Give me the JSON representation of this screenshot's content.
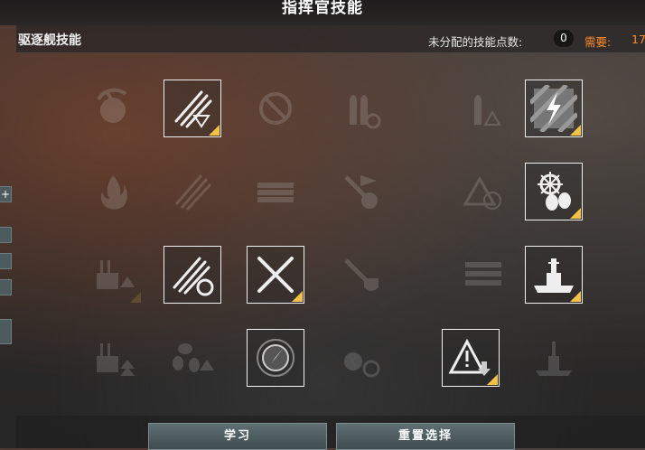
{
  "window": {
    "title": "指挥官技能"
  },
  "header": {
    "title": "驱逐舰技能",
    "points_label": "未分配的技能点数:",
    "points_value": "0",
    "required_label": "需要:",
    "required_value": "17"
  },
  "skills": {
    "row1": [
      {
        "icon": "priority-target-icon",
        "state": "locked"
      },
      {
        "icon": "torpedo-armament-icon",
        "state": "available"
      },
      {
        "icon": "no-entry-icon",
        "state": "locked"
      },
      {
        "icon": "ammo-reload-icon",
        "state": "locked"
      },
      {
        "icon": "ammo-warning-icon",
        "state": "locked"
      },
      {
        "icon": "electric-hazard-icon",
        "state": "available"
      }
    ],
    "row2": [
      {
        "icon": "fire-icon",
        "state": "locked"
      },
      {
        "icon": "torpedo-acceleration-icon",
        "state": "locked"
      },
      {
        "icon": "torpedo-tubes-icon",
        "state": "locked"
      },
      {
        "icon": "flag-explosion-icon",
        "state": "locked"
      },
      {
        "icon": "incoming-fire-alert-icon",
        "state": "locked"
      },
      {
        "icon": "engine-room-icon",
        "state": "available"
      }
    ],
    "row3": [
      {
        "icon": "turret-upgrade-icon",
        "state": "locked"
      },
      {
        "icon": "torpedo-reload-icon",
        "state": "available"
      },
      {
        "icon": "crossed-torpedoes-icon",
        "state": "available"
      },
      {
        "icon": "fire-shield-icon",
        "state": "locked"
      },
      {
        "icon": "torpedo-launcher-icon",
        "state": "locked"
      },
      {
        "icon": "battleship-icon",
        "state": "available"
      }
    ],
    "row4": [
      {
        "icon": "turret-boost-icon",
        "state": "locked"
      },
      {
        "icon": "propeller-boost-icon",
        "state": "locked"
      },
      {
        "icon": "radar-compass-icon",
        "state": "available"
      },
      {
        "icon": "shell-reload-icon",
        "state": "locked"
      },
      {
        "icon": "warning-down-icon",
        "state": "available"
      },
      {
        "icon": "ship-silhouette-icon",
        "state": "locked"
      }
    ]
  },
  "buttons": {
    "learn_label": "学习",
    "reset_label": "重置选择"
  },
  "colors": {
    "accent_orange": "#ff8c2a",
    "corner_marker": "#f5c248",
    "button_bg": "#4f5e62"
  }
}
